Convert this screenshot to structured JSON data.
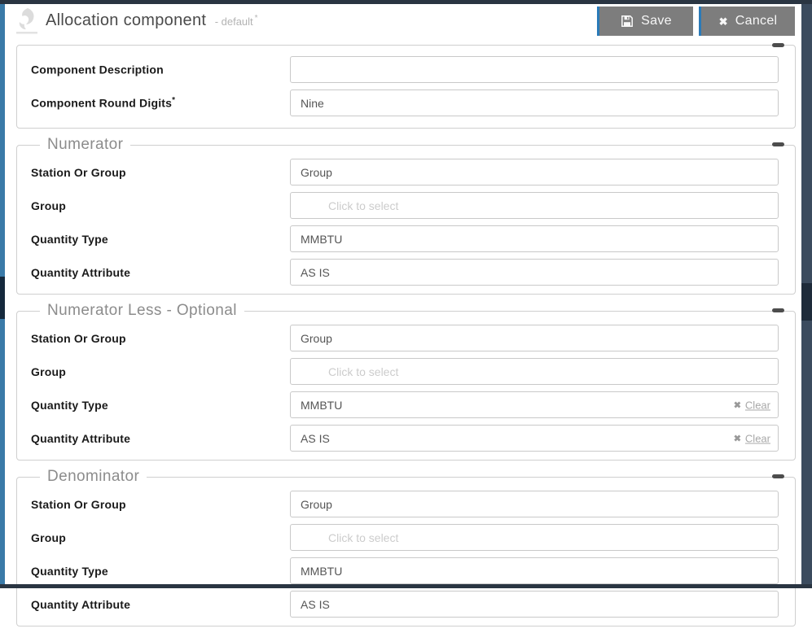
{
  "frame": {
    "colors": {
      "accent_blue": "#2a7ab8",
      "scrollbar_blue": "#3a7aa8",
      "chrome_dark": "#2a3542",
      "button_gray": "#7d7d7d"
    }
  },
  "header": {
    "title": "Allocation component",
    "subtitle": "- default",
    "unsaved_mark": "*",
    "save_label": "Save",
    "cancel_label": "Cancel",
    "cancel_icon": "✖"
  },
  "sections": [
    {
      "fields": [
        {
          "label": "Component Description",
          "value": "",
          "placeholder": ""
        },
        {
          "label": "Component Round Digits",
          "required": "*",
          "value": "Nine"
        }
      ]
    },
    {
      "legend": "Numerator",
      "fields": [
        {
          "label": "Station Or Group",
          "value": "Group"
        },
        {
          "label": "Group",
          "value": "",
          "placeholder": "Click to select"
        },
        {
          "label": "Quantity Type",
          "value": "MMBTU"
        },
        {
          "label": "Quantity Attribute",
          "value": "AS IS"
        }
      ]
    },
    {
      "legend": "Numerator Less - Optional",
      "fields": [
        {
          "label": "Station Or Group",
          "value": "Group"
        },
        {
          "label": "Group",
          "value": "",
          "placeholder": "Click to select"
        },
        {
          "label": "Quantity Type",
          "value": "MMBTU",
          "clear_icon": "✖",
          "clear_label": "Clear"
        },
        {
          "label": "Quantity Attribute",
          "value": "AS IS",
          "clear_icon": "✖",
          "clear_label": "Clear"
        }
      ]
    },
    {
      "legend": "Denominator",
      "fields": [
        {
          "label": "Station Or Group",
          "value": "Group"
        },
        {
          "label": "Group",
          "value": "",
          "placeholder": "Click to select"
        },
        {
          "label": "Quantity Type",
          "value": "MMBTU"
        },
        {
          "label": "Quantity Attribute",
          "value": "AS IS"
        }
      ]
    }
  ]
}
